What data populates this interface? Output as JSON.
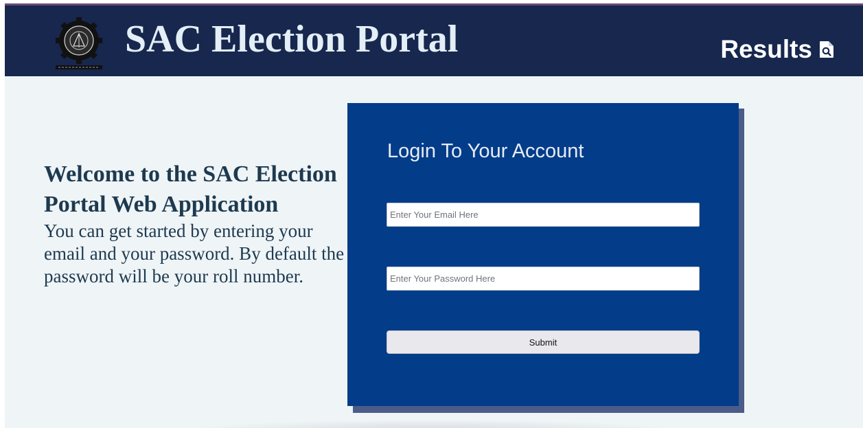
{
  "header": {
    "logo_icon": "institute-emblem-icon",
    "site_title": "SAC Election Portal",
    "results_link": {
      "label": "Results",
      "icon": "file-search-icon"
    }
  },
  "welcome": {
    "heading": "Welcome to the SAC Election Portal Web Application",
    "text": "You can get started by entering your email and your password. By default the password will be your roll number."
  },
  "login_form": {
    "title": "Login To Your Account",
    "email": {
      "value": "",
      "placeholder": "Enter Your Email Here"
    },
    "password": {
      "value": "",
      "placeholder": "Enter Your Password Here"
    },
    "submit_label": "Submit"
  },
  "colors": {
    "header_bg": "#17274e",
    "page_bg": "#eff4f7",
    "card_bg": "#033c89",
    "card_shadow": "#4d5b88",
    "heading_text": "#1d3a4f"
  }
}
